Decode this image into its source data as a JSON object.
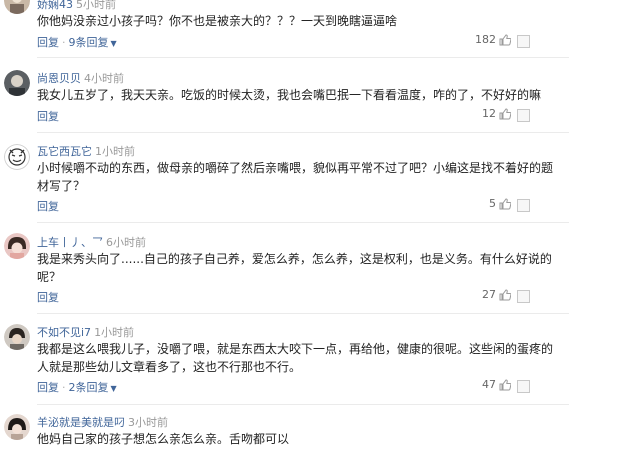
{
  "comments": [
    {
      "username": "娇娴43",
      "time": "5小时前",
      "text": "你他妈没亲过小孩子吗？你不也是被亲大的？？？一天到晚瞎逼逼啥",
      "reply_label": "回复",
      "replies_label": "9条回复",
      "likes": "182"
    },
    {
      "username": "尚恩贝贝",
      "time": "4小时前",
      "text": "我女儿五岁了，我天天亲。吃饭的时候太烫，我也会嘴巴抿一下看看温度，咋的了，不好好的嘛",
      "reply_label": "回复",
      "likes": "12"
    },
    {
      "username": "瓦它西瓦它",
      "time": "1小时前",
      "text": "小时候嚼不动的东西，做母亲的嚼碎了然后亲嘴喂，貌似再平常不过了吧？小编这是找不着好的题材写了？",
      "reply_label": "回复",
      "likes": "5"
    },
    {
      "username": "上车丨丿、乛",
      "time": "6小时前",
      "text": "我是来秀头向了......自己的孩子自己养，爱怎么养，怎么养，这是权利，也是义务。有什么好说的呢？",
      "reply_label": "回复",
      "likes": "27"
    },
    {
      "username": "不如不见i7",
      "time": "1小时前",
      "text": "我都是这么喂我儿子，没嚼了喂，就是东西太大咬下一点，再给他，健康的很呢。这些闲的蛋疼的人就是那些幼儿文章看多了，这也不行那也不行。",
      "reply_label": "回复",
      "replies_label": "2条回复",
      "likes": "47"
    },
    {
      "username": "羊泌就是美就是叼",
      "time": "3小时前",
      "text": "他妈自己家的孩子想怎么亲怎么亲。舌吻都可以"
    }
  ],
  "colors": {
    "username": "#406599",
    "time": "#999999",
    "text": "#222222",
    "action": "#406599"
  },
  "icons": {
    "like": "thumb-up-icon",
    "expand": "chevron-down-icon"
  }
}
